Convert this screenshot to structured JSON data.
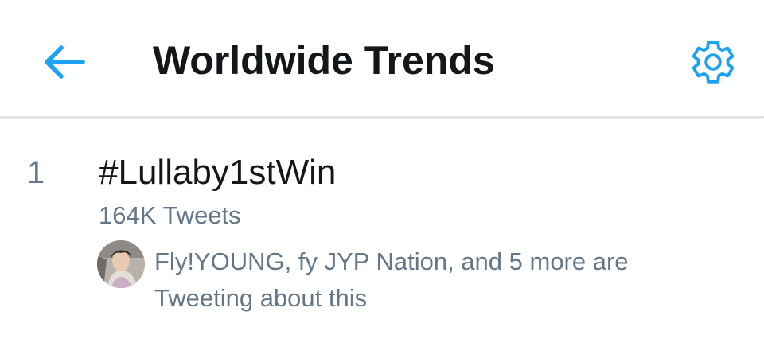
{
  "header": {
    "title": "Worldwide Trends",
    "back_icon": "arrow-left-icon",
    "settings_icon": "gear-icon",
    "accent_color": "#1da1f2"
  },
  "trend": {
    "rank": "1",
    "name": "#Lullaby1stWin",
    "tweet_count": "164K Tweets",
    "avatar": "user-avatar",
    "social_context": "Fly!YOUNG, fy JYP Nation, and 5 more are Tweeting about this"
  }
}
